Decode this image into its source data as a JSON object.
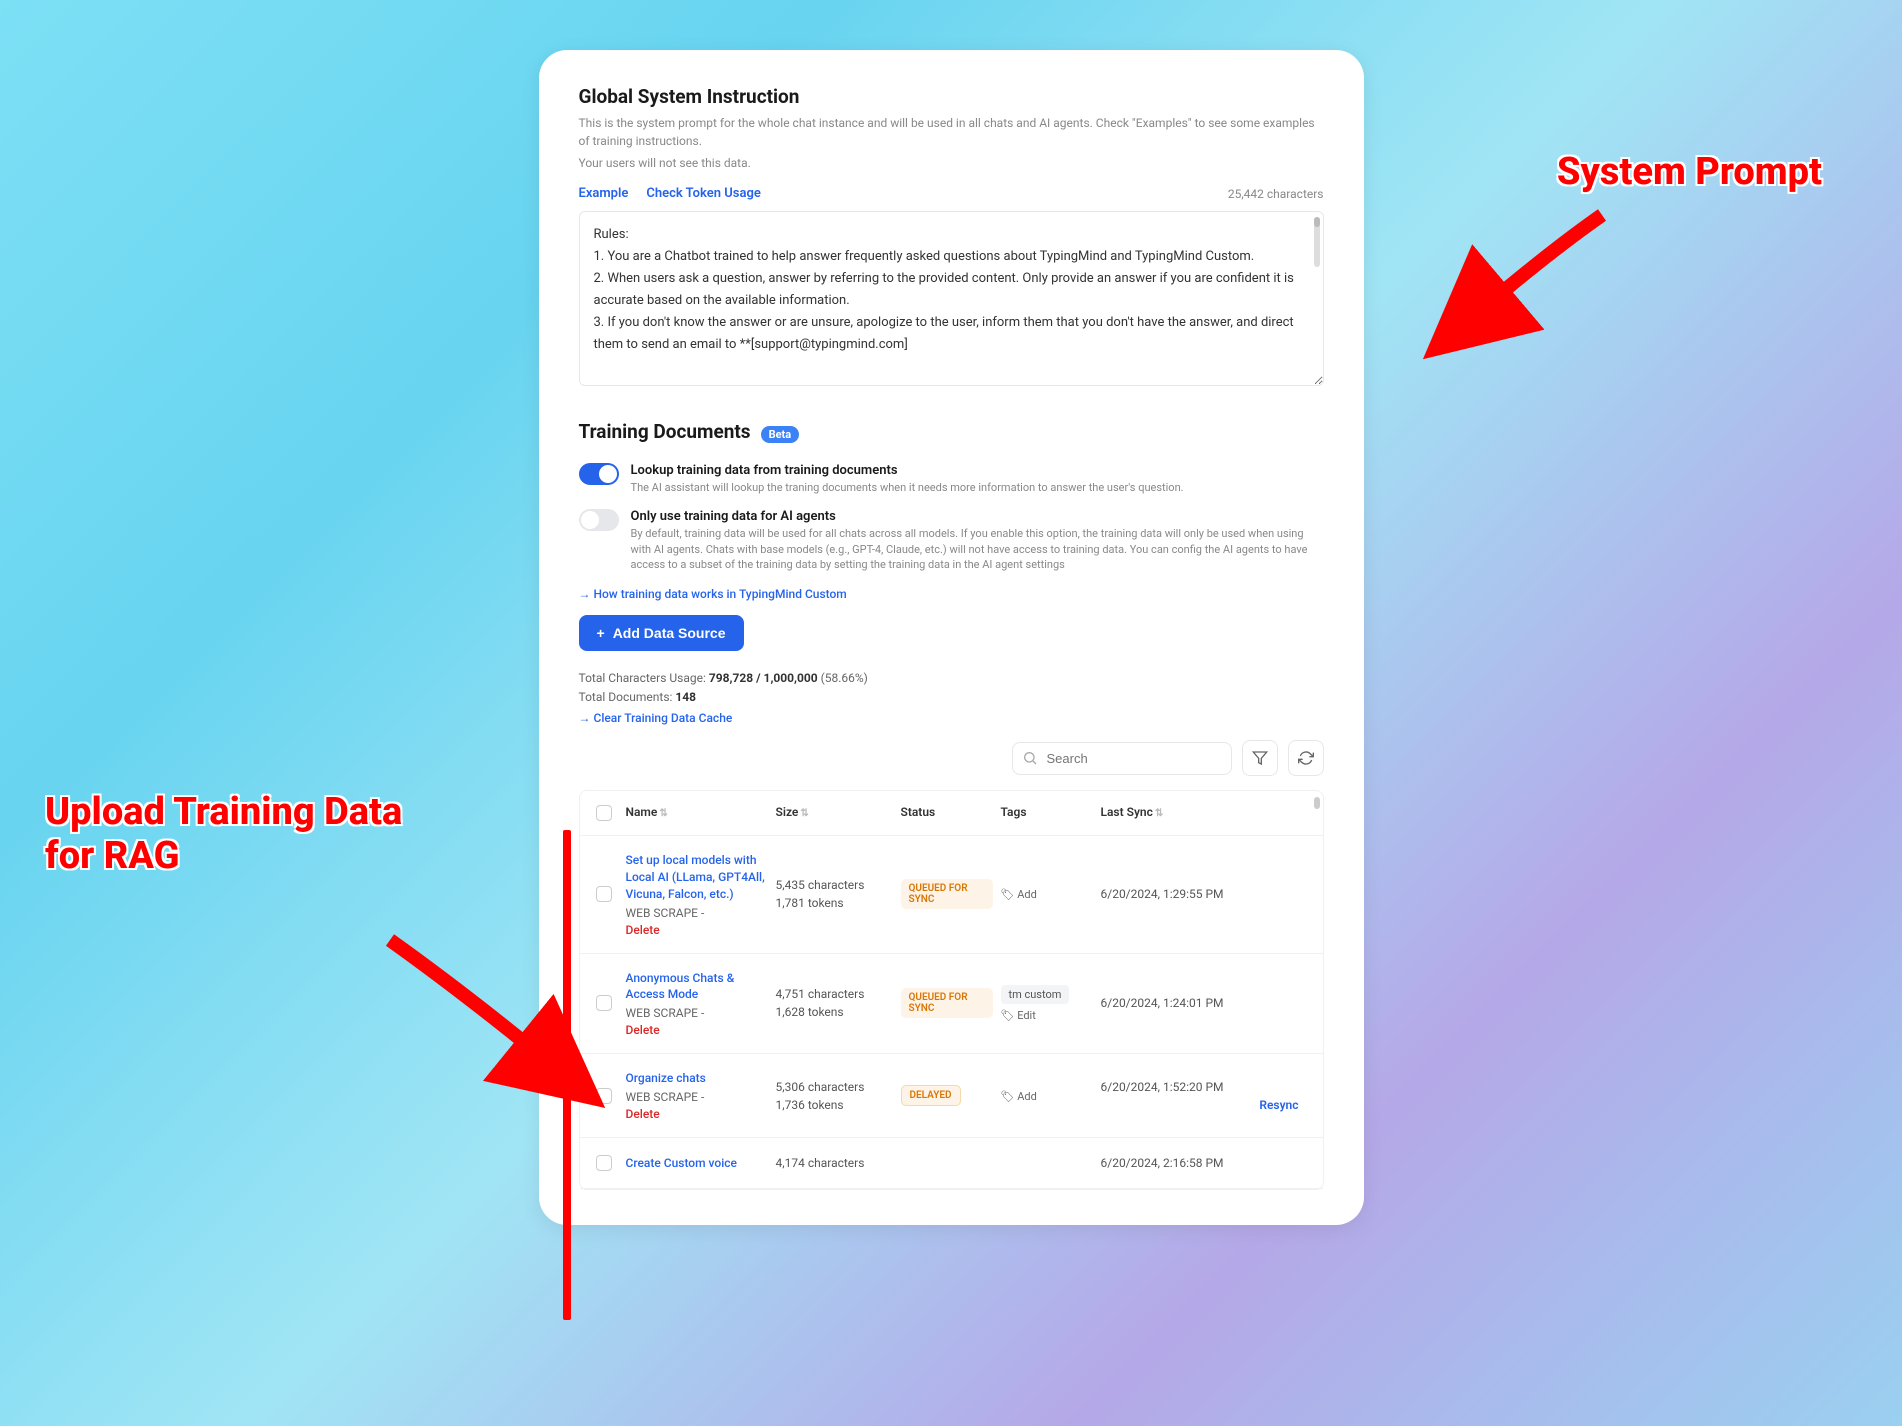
{
  "header": {
    "title": "Global System Instruction",
    "desc1": "This is the system prompt for the whole chat instance and will be used in all chats and AI agents. Check \"Examples\" to see some examples of training instructions.",
    "desc2": "Your users will not see this data.",
    "example_link": "Example",
    "token_link": "Check Token Usage",
    "char_count": "25,442 characters"
  },
  "system_prompt": "Rules:\n1. You are a Chatbot trained to help answer frequently asked questions about TypingMind and TypingMind Custom.\n2. When users ask a question, answer by referring to the provided content. Only provide an answer if you are confident it is accurate based on the available information.\n3. If you don't know the answer or are unsure, apologize to the user, inform them that you don't have the answer, and direct them to send an email to **[support@typingmind.com]",
  "training": {
    "title": "Training Documents",
    "beta": "Beta",
    "toggle1_title": "Lookup training data from training documents",
    "toggle1_desc": "The AI assistant will lookup the traning documents when it needs more information to answer the user's question.",
    "toggle2_title": "Only use training data for AI agents",
    "toggle2_desc": "By default, training data will be used for all chats across all models. If you enable this option, the training data will only be used when using with AI agents. Chats with base models (e.g., GPT-4, Claude, etc.) will not have access to training data. You can config the AI agents to have access to a subset of the training data by setting the training data in the AI agent settings",
    "how_link": "→ How training data works in TypingMind Custom",
    "add_btn": "Add Data Source",
    "usage_label": "Total Characters Usage: ",
    "usage_value": "798,728 / 1,000,000",
    "usage_pct": " (58.66%)",
    "docs_label": "Total Documents: ",
    "docs_value": "148",
    "clear_link": "→ Clear Training Data Cache",
    "search_placeholder": "Search"
  },
  "table": {
    "headers": {
      "name": "Name",
      "size": "Size",
      "status": "Status",
      "tags": "Tags",
      "sync": "Last Sync"
    },
    "rows": [
      {
        "title": "Set up local models with Local AI (LLama, GPT4All, Vicuna, Falcon, etc.)",
        "sub": "WEB SCRAPE -",
        "delete": "Delete",
        "size1": "5,435 characters",
        "size2": "1,781 tokens",
        "status": "QUEUED FOR SYNC",
        "status_class": "queued",
        "tags": [],
        "tag_action": "Add",
        "sync": "6/20/2024, 1:29:55 PM",
        "resync": ""
      },
      {
        "title": "Anonymous Chats & Access Mode",
        "sub": "WEB SCRAPE -",
        "delete": "Delete",
        "size1": "4,751 characters",
        "size2": "1,628 tokens",
        "status": "QUEUED FOR SYNC",
        "status_class": "queued",
        "tags": [
          "tm custom"
        ],
        "tag_action": "Edit",
        "sync": "6/20/2024, 1:24:01 PM",
        "resync": ""
      },
      {
        "title": "Organize chats",
        "sub": "WEB SCRAPE -",
        "delete": "Delete",
        "size1": "5,306 characters",
        "size2": "1,736 tokens",
        "status": "DELAYED",
        "status_class": "delayed",
        "tags": [],
        "tag_action": "Add",
        "sync": "6/20/2024, 1:52:20 PM",
        "resync": "Resync"
      },
      {
        "title": "Create Custom voice",
        "sub": "",
        "delete": "",
        "size1": "4,174 characters",
        "size2": "",
        "status": "",
        "status_class": "",
        "tags": [],
        "tag_action": "",
        "sync": "6/20/2024, 2:16:58 PM",
        "resync": ""
      }
    ]
  },
  "annotations": {
    "system_prompt": "System Prompt",
    "upload_rag": "Upload Training Data for RAG"
  }
}
